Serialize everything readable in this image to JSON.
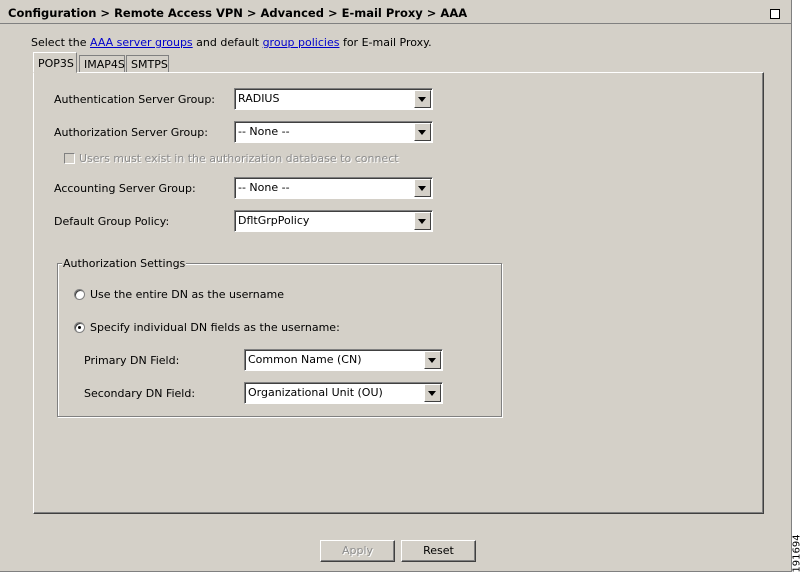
{
  "window": {
    "title": "Configuration > Remote Access VPN > Advanced > E-mail Proxy > AAA"
  },
  "intro": {
    "prefix": "Select the",
    "link1": "AAA server groups",
    "middle": "and default",
    "link2": "group policies",
    "suffix": "for E-mail Proxy."
  },
  "tabs": [
    {
      "label": "POP3S",
      "active": true
    },
    {
      "label": "IMAP4S",
      "active": false
    },
    {
      "label": "SMTPS",
      "active": false
    }
  ],
  "form": {
    "auth_server_group": {
      "label": "Authentication Server Group:",
      "value": "RADIUS"
    },
    "authz_server_group": {
      "label": "Authorization Server Group:",
      "value": "-- None --"
    },
    "users_must_exist": {
      "label": "Users must exist in the authorization database to connect",
      "checked": false,
      "disabled": true
    },
    "accounting_server_group": {
      "label": "Accounting Server Group:",
      "value": "-- None --"
    },
    "default_group_policy": {
      "label": "Default Group Policy:",
      "value": "DfltGrpPolicy"
    }
  },
  "authorization_settings": {
    "title": "Authorization Settings",
    "radio_entire_dn": {
      "label": "Use the entire DN as the username",
      "selected": false
    },
    "radio_individual_dn": {
      "label": "Specify individual DN fields as the username:",
      "selected": true
    },
    "primary_dn": {
      "label": "Primary DN Field:",
      "value": "Common Name (CN)"
    },
    "secondary_dn": {
      "label": "Secondary DN Field:",
      "value": "Organizational Unit (OU)"
    }
  },
  "buttons": {
    "apply": "Apply",
    "reset": "Reset"
  },
  "figure_id": "191694",
  "icons": {
    "maximize": "maximize-icon",
    "dropdown": "chevron-down-icon"
  }
}
